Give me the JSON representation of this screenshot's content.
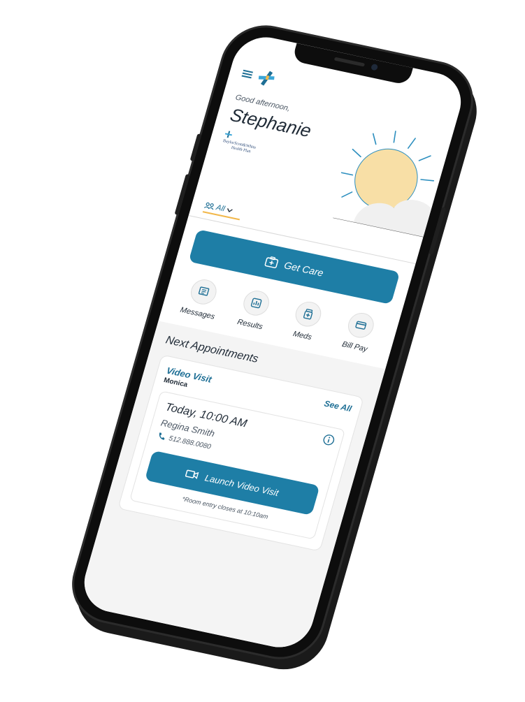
{
  "header": {
    "menu_icon": "hamburger-menu-icon",
    "logo_icon": "cross-logo-icon"
  },
  "greeting": {
    "salutation": "Good afternoon,",
    "name": "Stephanie",
    "plan_brand_line1": "BaylorScott&White",
    "plan_brand_line2": "Health Plan"
  },
  "member_selector": {
    "label": "All",
    "icon": "people-icon",
    "accent_color": "#f2b84b"
  },
  "actions": {
    "get_care_label": "Get Care",
    "get_care_icon": "medical-bag-icon"
  },
  "quick_links": [
    {
      "label": "Messages",
      "icon": "message-icon"
    },
    {
      "label": "Results",
      "icon": "chart-icon"
    },
    {
      "label": "Meds",
      "icon": "medicine-icon"
    },
    {
      "label": "Bill Pay",
      "icon": "credit-card-icon"
    }
  ],
  "appointments": {
    "section_title": "Next Appointments",
    "see_all_label": "See All",
    "item": {
      "type": "Video Visit",
      "patient": "Monica",
      "when": "Today, 10:00 AM",
      "provider": "Regina Smith",
      "phone": "512.888.0080",
      "launch_label": "Launch Video Visit",
      "note": "*Room entry closes at 10:10am"
    }
  },
  "colors": {
    "primary": "#1e7ea6",
    "text": "#1f2a36",
    "sun": "#f8dfa6",
    "sun_rays": "#2d8fbf"
  }
}
